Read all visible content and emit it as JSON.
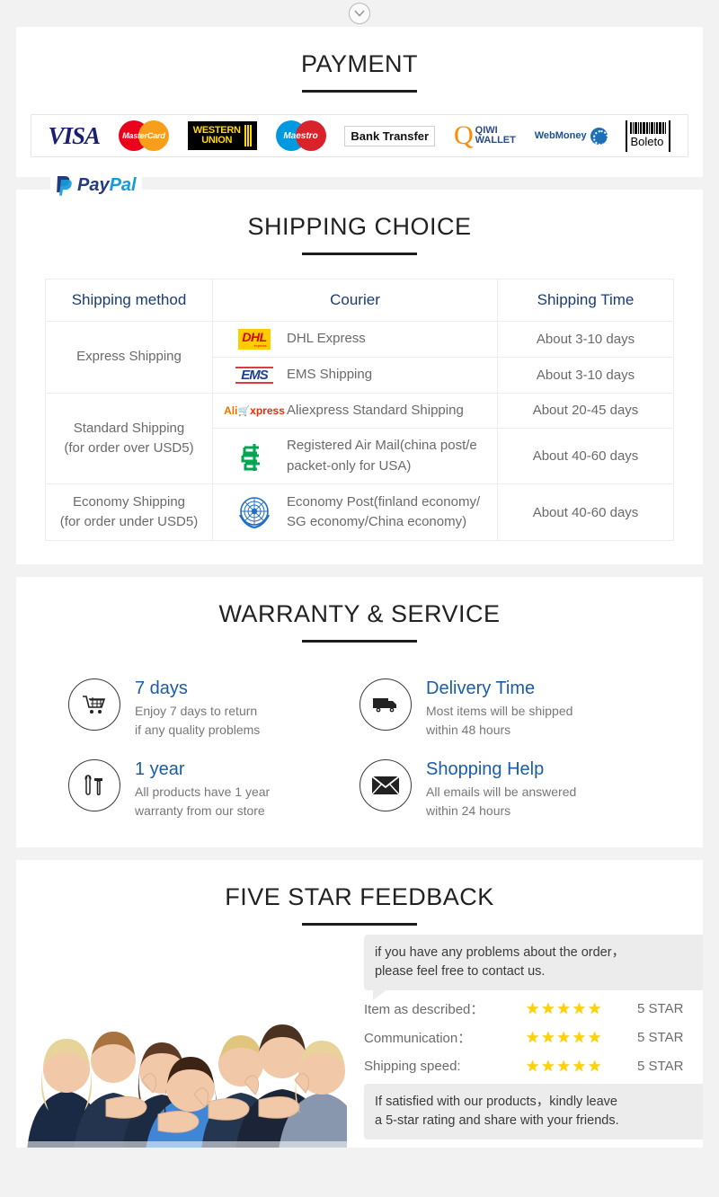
{
  "top": {
    "collapse_icon": "chevron-down-icon"
  },
  "payment": {
    "title": "PAYMENT",
    "methods": [
      {
        "name": "visa",
        "label": "VISA"
      },
      {
        "name": "mastercard",
        "label": "MasterCard"
      },
      {
        "name": "western-union",
        "label_line1": "WESTERN",
        "label_line2": "UNION"
      },
      {
        "name": "maestro",
        "label": "Maestro"
      },
      {
        "name": "bank-transfer",
        "label": "Bank Transfer"
      },
      {
        "name": "qiwi-wallet",
        "label_line1": "QIWI",
        "label_line2": "WALLET"
      },
      {
        "name": "webmoney",
        "label": "WebMoney"
      },
      {
        "name": "boleto",
        "label": "Boleto"
      }
    ],
    "paypal": {
      "a": "Pay",
      "b": "Pal"
    }
  },
  "shipping": {
    "title": "SHIPPING CHOICE",
    "columns": [
      "Shipping method",
      "Courier",
      "Shipping Time"
    ],
    "rows": [
      {
        "method": "Express Shipping",
        "method_rowspan": 2,
        "logo": "dhl-logo",
        "courier": "DHL Express",
        "time": "About 3-10 days"
      },
      {
        "method": null,
        "logo": "ems-logo",
        "courier": "EMS Shipping",
        "time": "About 3-10 days"
      },
      {
        "method": "Standard Shipping\n(for order over USD5)",
        "method_rowspan": 2,
        "logo": "aliexpress-logo",
        "courier": "Aliexpress Standard Shipping",
        "time": "About 20-45 days"
      },
      {
        "method": null,
        "logo": "china-post-logo",
        "courier": "Registered Air Mail(china post/e packet-only for USA)",
        "time": "About 40-60 days"
      },
      {
        "method": "Economy Shipping\n(for order under USD5)",
        "method_rowspan": 1,
        "logo": "un-logo",
        "courier": "Economy Post(finland economy/ SG economy/China economy)",
        "time": "About 40-60 days"
      }
    ],
    "method_labels": {
      "express": "Express Shipping",
      "standard_l1": "Standard Shipping",
      "standard_l2": "(for order over USD5)",
      "economy_l1": "Economy Shipping",
      "economy_l2": "(for order under USD5)"
    },
    "couriers": {
      "dhl": "DHL Express",
      "ems": "EMS Shipping",
      "ali": "Aliexpress Standard Shipping",
      "air_l1": "Registered Air Mail(china post/e",
      "air_l2": "packet-only for USA)",
      "eco_l1": "Economy Post(finland economy/",
      "eco_l2": "SG economy/China economy)"
    },
    "times": {
      "dhl": "About 3-10 days",
      "ems": "About 3-10 days",
      "ali": "About 20-45 days",
      "air": "About 40-60 days",
      "eco": "About 40-60 days"
    },
    "logo_text": {
      "dhl": "DHL",
      "dhl_sub": "express",
      "ems": "EMS",
      "ali_a": "Ali",
      "ali_x": "xpress"
    }
  },
  "warranty": {
    "title": "WARRANTY & SERVICE",
    "items": [
      {
        "icon": "shopping-cart-icon",
        "head": "7 days",
        "l1": "Enjoy 7 days to return",
        "l2": "if any quality problems"
      },
      {
        "icon": "delivery-truck-icon",
        "head": "Delivery Time",
        "l1": "Most items will be shipped",
        "l2": "within 48 hours"
      },
      {
        "icon": "tools-icon",
        "head": "1 year",
        "l1": "All products have 1 year",
        "l2": "warranty from our store"
      },
      {
        "icon": "envelope-icon",
        "head": "Shopping Help",
        "l1": "All emails will be answered",
        "l2": "within 24 hours"
      }
    ]
  },
  "feedback": {
    "title": "FIVE STAR FEEDBACK",
    "image": "happy-customers-photo",
    "bubble_top_l1": "if you have any problems about the order，",
    "bubble_top_l2": "please feel free to contact us.",
    "ratings": [
      {
        "label": "Item as described：",
        "stars": 5,
        "value": "5 STAR"
      },
      {
        "label": "Communication：",
        "stars": 5,
        "value": "5 STAR"
      },
      {
        "label": "Shipping speed:",
        "stars": 5,
        "value": "5 STAR"
      }
    ],
    "bubble_bottom_l1": "If satisfied with our products，kindly leave",
    "bubble_bottom_l2": "a 5-star rating and share with your friends.",
    "star_glyph": "★"
  },
  "colors": {
    "heading": "#222222",
    "table_header": "#1b3c73",
    "body_text": "#6a6a6a",
    "accent_blue": "#1b5ca8",
    "star_yellow": "#fcd307",
    "page_bg": "#f2f2f2"
  }
}
